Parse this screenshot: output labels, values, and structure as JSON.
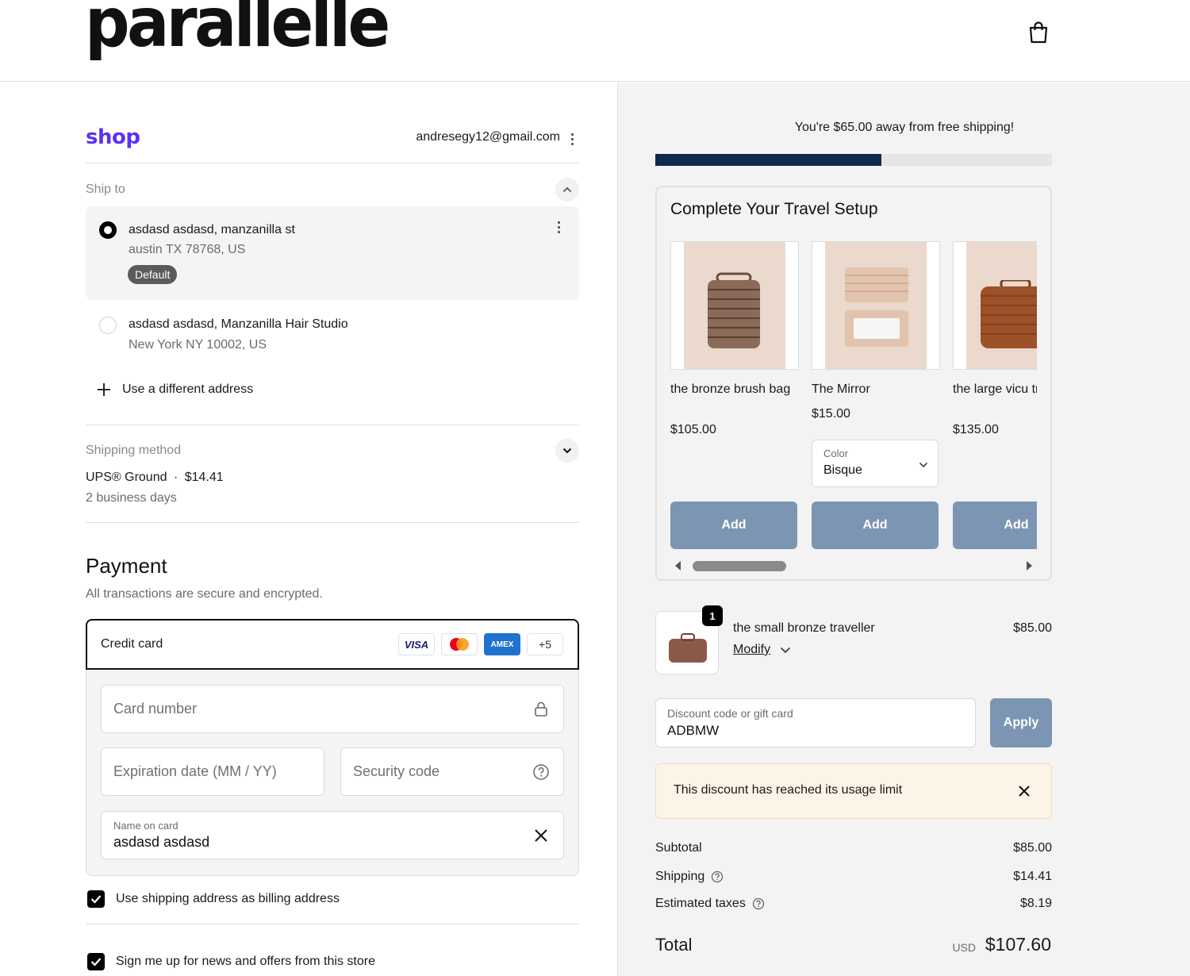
{
  "brand": {
    "logo_text": "parallelle",
    "cart_icon": "shopping-bag-icon"
  },
  "shop_pay": {
    "logo": "shop",
    "email": "andresegy12@gmail.com"
  },
  "ship_to": {
    "label": "Ship to",
    "addresses": [
      {
        "name": "asdasd asdasd, manzanilla st",
        "line2": "austin TX 78768, US",
        "badge": "Default",
        "selected": true
      },
      {
        "name": "asdasd asdasd, Manzanilla Hair Studio",
        "line2": "New York NY 10002, US",
        "selected": false
      }
    ],
    "add_new": "Use a different address"
  },
  "shipping_method": {
    "label": "Shipping method",
    "carrier": "UPS® Ground",
    "separator": "·",
    "price": "$14.41",
    "eta": "2 business days"
  },
  "payment": {
    "title": "Payment",
    "subtitle": "All transactions are secure and encrypted.",
    "method_label": "Credit card",
    "card_brands": [
      "VISA",
      "mastercard",
      "AMEX",
      "+5"
    ],
    "card_number_placeholder": "Card number",
    "expiry_placeholder": "Expiration date (MM / YY)",
    "cvc_placeholder": "Security code",
    "name_label": "Name on card",
    "name_value": "asdasd asdasd"
  },
  "options": {
    "billing_same": "Use shipping address as billing address",
    "newsletter": "Sign me up for news and offers from this store"
  },
  "summary": {
    "free_shipping_msg": "You're $65.00 away from free shipping!",
    "free_shipping_progress": 0.57,
    "upsell_title": "Complete Your Travel Setup",
    "products": [
      {
        "name": "the bronze brush bag",
        "price": "$105.00",
        "add": "Add"
      },
      {
        "name": "The Mirror",
        "price": "$15.00",
        "select_label": "Color",
        "select_value": "Bisque",
        "add": "Add"
      },
      {
        "name": "the large vicu traveller",
        "price": "$135.00",
        "add": "Add"
      }
    ],
    "line_item": {
      "name": "the small bronze traveller",
      "qty": "1",
      "modify": "Modify",
      "price": "$85.00"
    },
    "discount": {
      "label": "Discount code or gift card",
      "value": "ADBMW",
      "apply": "Apply"
    },
    "alert": "This discount has reached its usage limit",
    "subtotal_label": "Subtotal",
    "subtotal": "$85.00",
    "shipping_label": "Shipping",
    "shipping": "$14.41",
    "taxes_label": "Estimated taxes",
    "taxes": "$8.19",
    "total_label": "Total",
    "currency": "USD",
    "total": "$107.60"
  },
  "colors": {
    "accent_button": "#7c95b3",
    "progress": "#0f2a4b",
    "shop_purple": "#5a31f4"
  }
}
